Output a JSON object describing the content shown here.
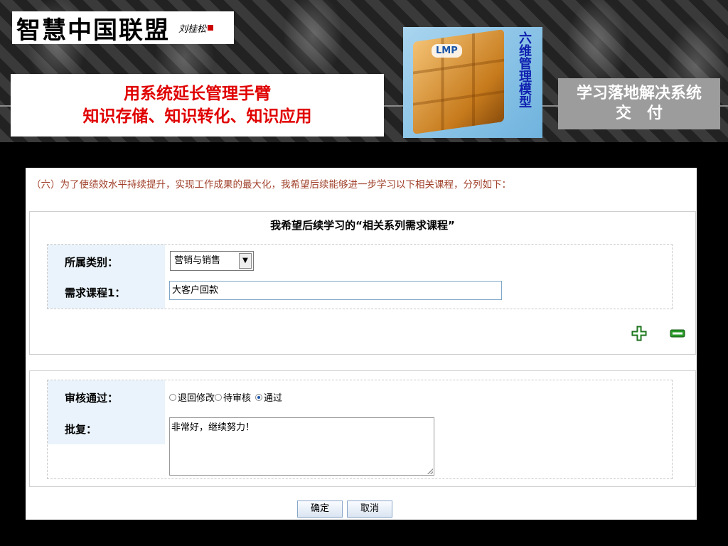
{
  "header": {
    "logo_text": "智慧中国联盟",
    "logo_signature": "刘桂松",
    "slogan_line1": "用系统延长管理手臂",
    "slogan_line2": "知识存储、知识转化、知识应用",
    "cube_logo": "LMP",
    "cube_caption": "六维管理模型",
    "deliver_line1": "学习落地解决系统",
    "deliver_line2": "交　付"
  },
  "form": {
    "intro": "（六）为了使绩效水平持续提升，实现工作成果的最大化，我希望后续能够进一步学习以下相关课程，分列如下：",
    "panel_title": "我希望后续学习的“相关系列需求课程”",
    "category_label": "所属类别：",
    "category_value": "营销与销售",
    "course_label": "需求课程1：",
    "course_value": "大客户回款",
    "review_label": "审核通过：",
    "review_options": [
      "退回修改",
      "待审核",
      "通过"
    ],
    "reply_label": "批复：",
    "reply_value": "非常好，继续努力！",
    "confirm_label": "确定",
    "cancel_label": "取消"
  },
  "colors": {
    "slogan": "#e00000",
    "intro": "#a0402a",
    "label_bg": "#eaf3fb",
    "icon_green": "#2a9a2a"
  }
}
